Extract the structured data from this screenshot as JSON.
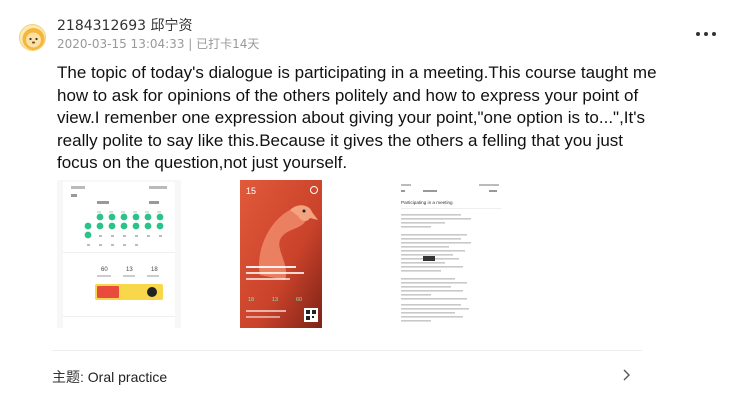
{
  "post": {
    "username": "2184312693 邱宁资",
    "timestamp": "2020-03-15 13:04:33",
    "separator": "|",
    "checkin_status": "已打卡14天",
    "text": "The topic of today's dialogue is participating in a meeting.This course taught me how to ask for opinions of the others politely and how to express your point of view.I remenber one expression about giving your point,\"one option is to...\",It's really polite to say like this.Because it gives the others a felling that you just focus on the question,not just yourself."
  },
  "images": [
    {
      "name": "calendar-checkin-screenshot",
      "stats": [
        "60",
        "13",
        "18"
      ]
    },
    {
      "name": "flamingo-daily-card",
      "day": "15",
      "stats": [
        "18",
        "13",
        "60"
      ]
    },
    {
      "name": "participating-in-a-meeting-transcript",
      "title": "Participating in a meeting"
    }
  ],
  "topic": {
    "prefix": "主题:",
    "label": "Oral practice"
  },
  "icons": {
    "more": "more-dots-icon",
    "chevron": "chevron-right-icon",
    "avatar": "cartoon-lion-avatar"
  }
}
